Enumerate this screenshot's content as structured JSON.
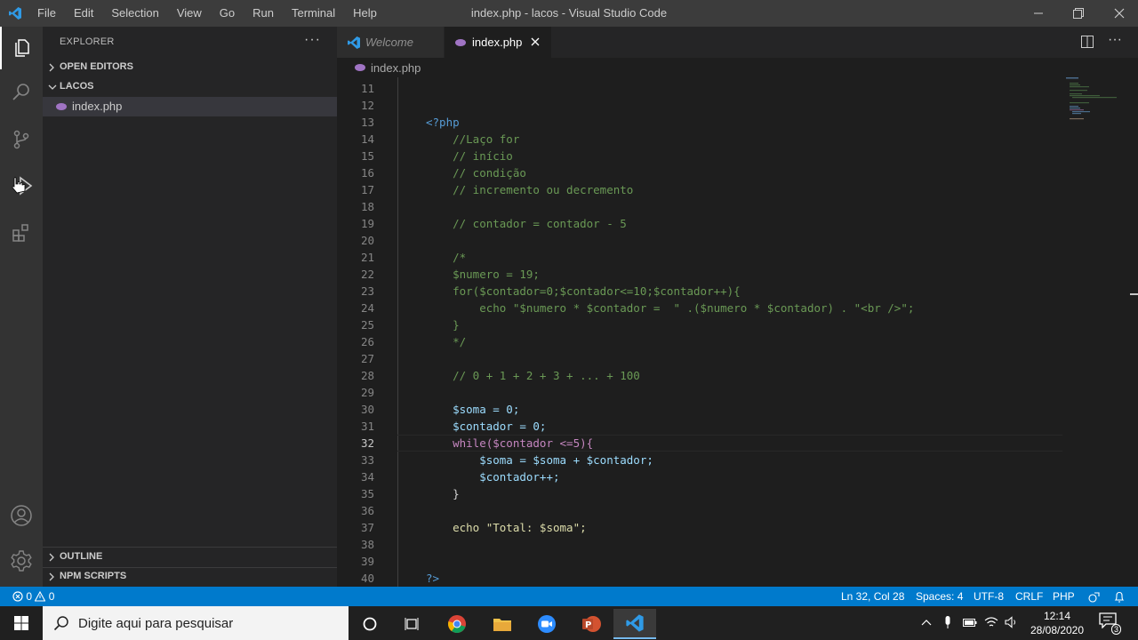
{
  "window": {
    "title": "index.php - lacos - Visual Studio Code",
    "menu": [
      "File",
      "Edit",
      "Selection",
      "View",
      "Go",
      "Run",
      "Terminal",
      "Help"
    ]
  },
  "sidebar": {
    "title": "EXPLORER",
    "more": "···",
    "sections": {
      "open_editors": "OPEN EDITORS",
      "folder": "LACOS",
      "outline": "OUTLINE",
      "npm": "NPM SCRIPTS"
    },
    "files": [
      {
        "name": "index.php",
        "icon": "php-icon"
      }
    ]
  },
  "tabs": [
    {
      "label": "Welcome",
      "active": false
    },
    {
      "label": "index.php",
      "active": true
    }
  ],
  "breadcrumb": "index.php",
  "editor": {
    "lines": [
      {
        "n": "11",
        "t": ""
      },
      {
        "n": "12",
        "t": ""
      },
      {
        "n": "13",
        "t": "<?php"
      },
      {
        "n": "14",
        "t": "    //Laço for"
      },
      {
        "n": "15",
        "t": "    // início"
      },
      {
        "n": "16",
        "t": "    // condição"
      },
      {
        "n": "17",
        "t": "    // incremento ou decremento"
      },
      {
        "n": "18",
        "t": ""
      },
      {
        "n": "19",
        "t": "    // contador = contador - 5"
      },
      {
        "n": "20",
        "t": ""
      },
      {
        "n": "21",
        "t": "    /*"
      },
      {
        "n": "22",
        "t": "    $numero = 19;"
      },
      {
        "n": "23",
        "t": "    for($contador=0;$contador<=10;$contador++){"
      },
      {
        "n": "24",
        "t": "        echo \"$numero * $contador =  \" .($numero * $contador) . \"<br />\";"
      },
      {
        "n": "25",
        "t": "    }"
      },
      {
        "n": "26",
        "t": "    */"
      },
      {
        "n": "27",
        "t": ""
      },
      {
        "n": "28",
        "t": "    // 0 + 1 + 2 + 3 + ... + 100"
      },
      {
        "n": "29",
        "t": ""
      },
      {
        "n": "30",
        "t": "    $soma = 0;"
      },
      {
        "n": "31",
        "t": "    $contador = 0;"
      },
      {
        "n": "32",
        "t": "    while($contador <=5){"
      },
      {
        "n": "33",
        "t": "        $soma = $soma + $contador;"
      },
      {
        "n": "34",
        "t": "        $contador++;"
      },
      {
        "n": "35",
        "t": "    }"
      },
      {
        "n": "36",
        "t": ""
      },
      {
        "n": "37",
        "t": "    echo \"Total: $soma\";"
      },
      {
        "n": "38",
        "t": ""
      },
      {
        "n": "39",
        "t": ""
      },
      {
        "n": "40",
        "t": "?>"
      }
    ]
  },
  "statusbar": {
    "problems": "0",
    "warnings": "0",
    "position": "Ln 32, Col 28",
    "spaces": "Spaces: 4",
    "encoding": "UTF-8",
    "eol": "CRLF",
    "language": "PHP"
  },
  "taskbar": {
    "search_placeholder": "Digite aqui para pesquisar",
    "time": "12:14",
    "date": "28/08/2020",
    "notifications": "3"
  },
  "colors": {
    "accent": "#007acc",
    "titlebar": "#3c3c3c",
    "sidebar": "#252526",
    "editor": "#1e1e1e"
  }
}
